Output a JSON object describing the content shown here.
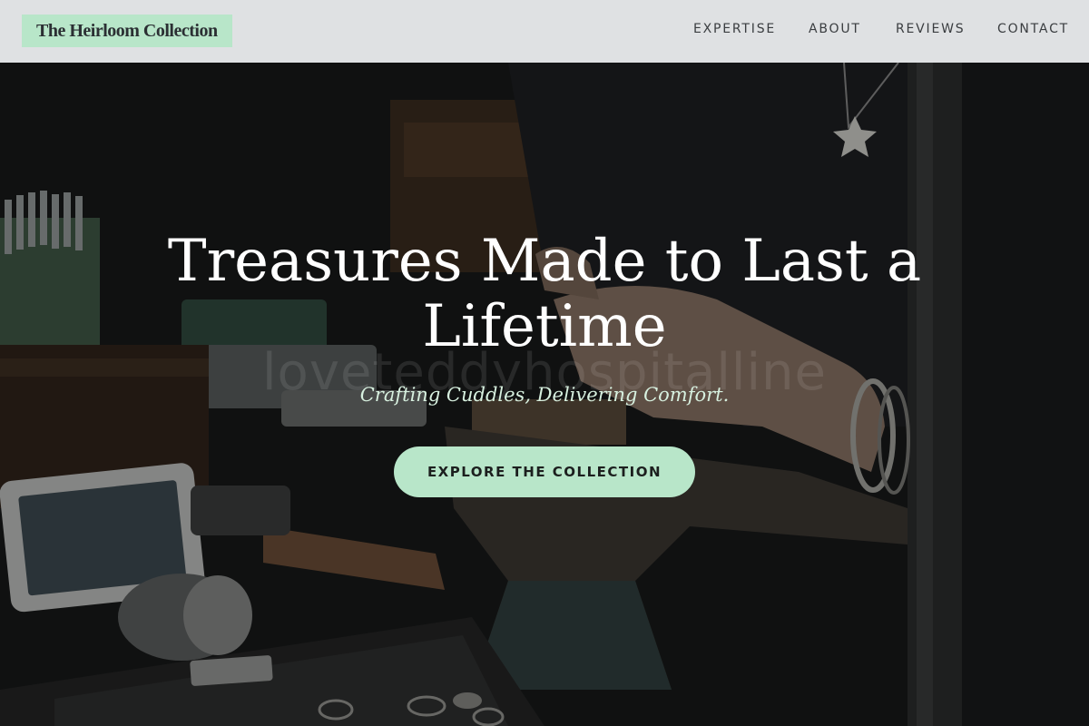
{
  "header": {
    "brand": "The Heirloom Collection",
    "nav": [
      {
        "label": "EXPERTISE"
      },
      {
        "label": "ABOUT"
      },
      {
        "label": "REVIEWS"
      },
      {
        "label": "CONTACT"
      }
    ]
  },
  "hero": {
    "headline": "Treasures Made to Last a Lifetime",
    "tagline": "Crafting Cuddles, Delivering Comfort.",
    "cta_label": "EXPLORE THE COLLECTION",
    "watermark": "loveteddyhospitalline"
  },
  "colors": {
    "accent": "#b8e6c9",
    "navbar_bg": "#eceef0",
    "headline_text": "#ffffff",
    "tagline_text": "#d7f0df"
  }
}
